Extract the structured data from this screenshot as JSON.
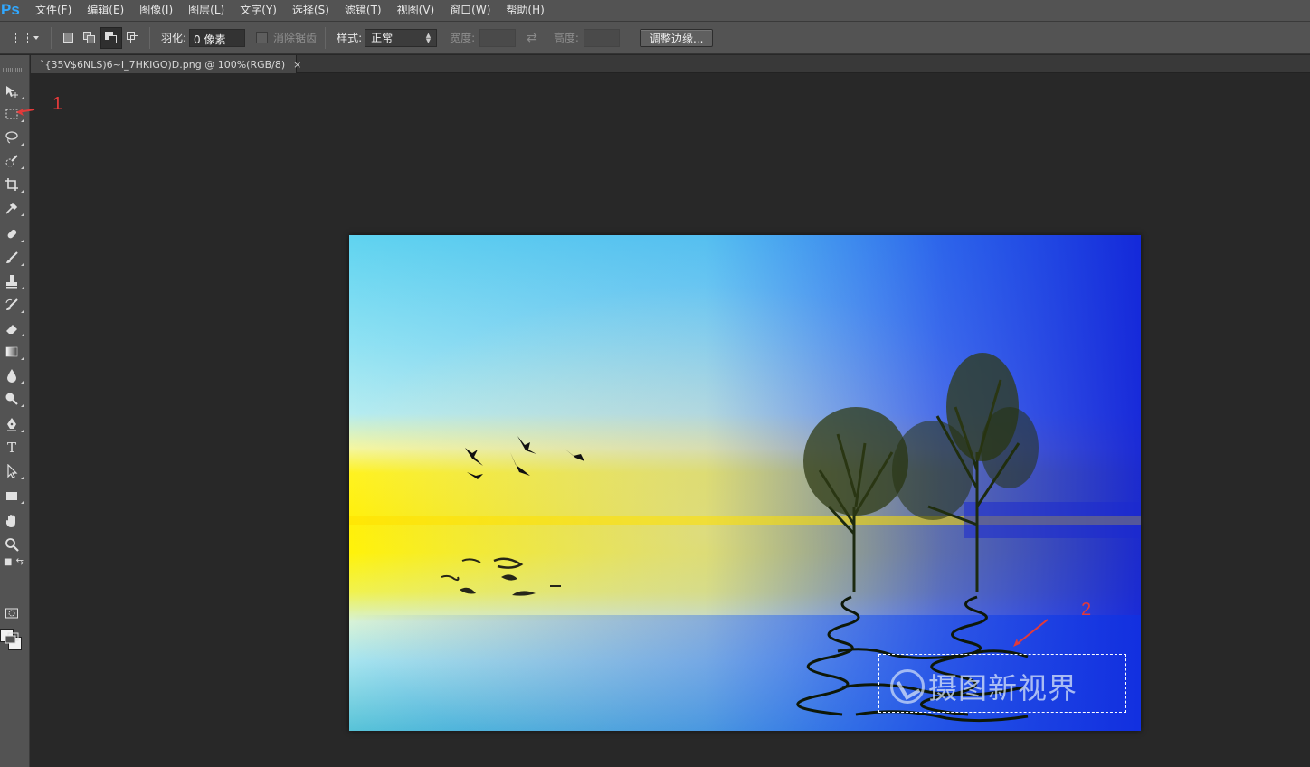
{
  "app": {
    "logo": "Ps"
  },
  "menu": [
    "文件(F)",
    "编辑(E)",
    "图像(I)",
    "图层(L)",
    "文字(Y)",
    "选择(S)",
    "滤镜(T)",
    "视图(V)",
    "窗口(W)",
    "帮助(H)"
  ],
  "options": {
    "feather_label": "羽化:",
    "feather_value": "0 像素",
    "antialias_label": "消除锯齿",
    "style_label": "样式:",
    "style_value": "正常",
    "width_label": "宽度:",
    "height_label": "高度:",
    "refine_button": "调整边缘..."
  },
  "document": {
    "tab_title": "`{35V$6NLS)6~I_7HKIGO)D.png @ 100%(RGB/8)",
    "close_glyph": "×"
  },
  "annotations": {
    "marker1": "1",
    "marker2": "2",
    "annotation_color": "#e33a3a"
  },
  "image": {
    "watermark_text": "摄图新视界"
  },
  "tools": [
    "move-tool",
    "rectangular-marquee-tool",
    "lasso-tool",
    "quick-selection-tool",
    "crop-tool",
    "eyedropper-tool",
    "spot-healing-tool",
    "brush-tool",
    "clone-stamp-tool",
    "history-brush-tool",
    "eraser-tool",
    "gradient-tool",
    "blur-tool",
    "dodge-tool",
    "pen-tool",
    "type-tool",
    "path-selection-tool",
    "rectangle-tool",
    "hand-tool",
    "zoom-tool"
  ],
  "colors": {
    "foreground": "#f2f2f2",
    "background": "#f2f2f2",
    "accent": "#31a8ff"
  }
}
